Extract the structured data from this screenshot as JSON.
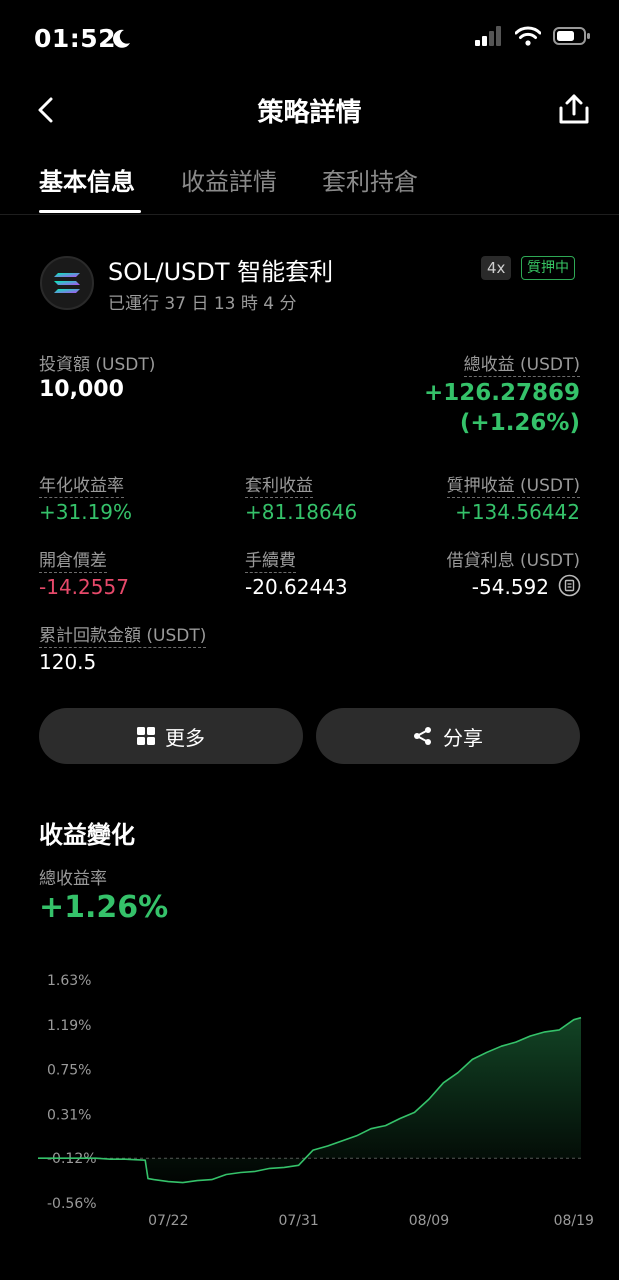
{
  "status_bar": {
    "time": "01:52"
  },
  "nav": {
    "title": "策略詳情"
  },
  "tabs": [
    {
      "label": "基本信息"
    },
    {
      "label": "收益詳情"
    },
    {
      "label": "套利持倉"
    }
  ],
  "strategy": {
    "pair": "SOL/USDT 智能套利",
    "running_time": "已運行 37 日 13 時 4 分",
    "leverage": "4x",
    "status": "質押中"
  },
  "stats": {
    "investment_label": "投資額 (USDT)",
    "investment_value": "10,000",
    "total_profit_label": "總收益 (USDT)",
    "total_profit_value": "+126.27869",
    "total_profit_pct": "(+1.26%)",
    "annual_label": "年化收益率",
    "annual_value": "+31.19%",
    "arb_label": "套利收益",
    "arb_value": "+81.18646",
    "pledge_label": "質押收益 (USDT)",
    "pledge_value": "+134.56442",
    "spread_label": "開倉價差",
    "spread_value": "-14.2557",
    "fee_label": "手續費",
    "fee_value": "-20.62443",
    "interest_label": "借貸利息 (USDT)",
    "interest_value": "-54.592",
    "refund_label": "累計回款金額 (USDT)",
    "refund_value": "120.5"
  },
  "buttons": {
    "more": "更多",
    "share": "分享"
  },
  "chart_section": {
    "title": "收益變化",
    "rate_label": "總收益率",
    "rate_value": "+1.26%"
  },
  "colors": {
    "green": "#35c26a",
    "red": "#e6496a",
    "bg": "#000000"
  },
  "chart_data": {
    "type": "area",
    "ylabel": "",
    "xlabel": "",
    "y_ticks": [
      "1.63%",
      "1.19%",
      "0.75%",
      "0.31%",
      "-0.12%",
      "-0.56%"
    ],
    "y_tick_values": [
      1.63,
      1.19,
      0.75,
      0.31,
      -0.12,
      -0.56
    ],
    "x_ticks": [
      "07/22",
      "07/31",
      "08/09",
      "08/19"
    ],
    "x_tick_days": [
      9,
      18,
      27,
      37
    ],
    "ylim": [
      -0.56,
      1.63
    ],
    "xlim": [
      0,
      37.5
    ],
    "series": [
      {
        "x": [
          0,
          2,
          4,
          5,
          6,
          7.4,
          7.6,
          8,
          9,
          10,
          11,
          12,
          13,
          14,
          15,
          16,
          17,
          18,
          19,
          20,
          21,
          22,
          23,
          24,
          25,
          26,
          27,
          28,
          29,
          30,
          31,
          32,
          33,
          34,
          35,
          36,
          37,
          37.5
        ],
        "values": [
          -0.12,
          -0.12,
          -0.12,
          -0.13,
          -0.13,
          -0.14,
          -0.32,
          -0.33,
          -0.35,
          -0.36,
          -0.34,
          -0.33,
          -0.28,
          -0.26,
          -0.25,
          -0.22,
          -0.21,
          -0.19,
          -0.04,
          0.0,
          0.05,
          0.1,
          0.17,
          0.2,
          0.27,
          0.33,
          0.46,
          0.62,
          0.72,
          0.85,
          0.92,
          0.98,
          1.02,
          1.08,
          1.12,
          1.14,
          1.24,
          1.26
        ]
      }
    ]
  }
}
